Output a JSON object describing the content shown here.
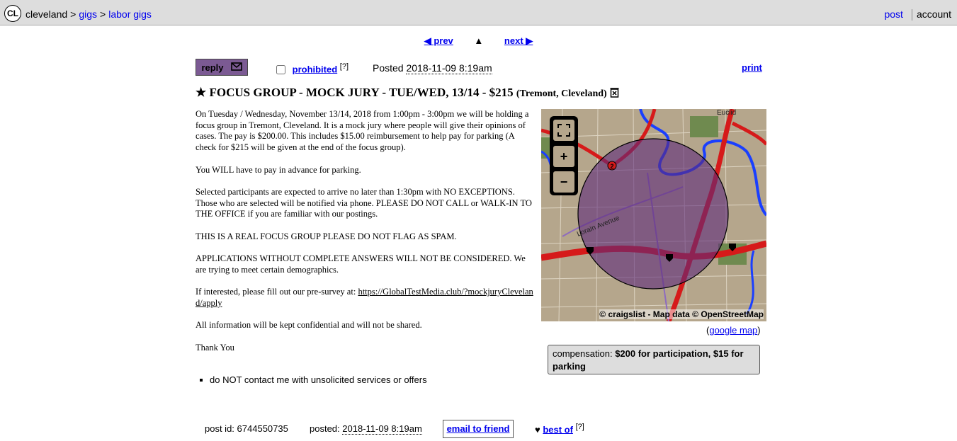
{
  "header": {
    "logo": "CL",
    "breadcrumb": [
      {
        "label": "cleveland",
        "link": false
      },
      {
        "label": "gigs",
        "link": true
      },
      {
        "label": "labor gigs",
        "link": true
      }
    ],
    "sep": ">",
    "post_label": "post",
    "account_label": "account"
  },
  "pager": {
    "prev_label": "◀ prev",
    "up_label": "▲",
    "next_label": "next ▶"
  },
  "actions": {
    "reply_label": "reply",
    "prohibited_label": "prohibited",
    "help_mark": "[?]",
    "posted_label": "Posted",
    "posted_date": "2018-11-09 8:19am",
    "print_label": "print"
  },
  "title": {
    "star": "★",
    "text": "FOCUS GROUP - MOCK JURY - TUE/WED, 13/14 - $215",
    "location": "(Tremont, Cleveland)"
  },
  "body": {
    "paragraphs": [
      "On Tuesday / Wednesday, November 13/14, 2018 from 1:00pm - 3:00pm we will be holding a focus group in Tremont, Cleveland. It is a mock jury where people will give their opinions of cases. The pay is $200.00. This includes $15.00 reimbursement to help pay for parking (A check for $215 will be given at the end of the focus group).",
      "You WILL have to pay in advance for parking.",
      "Selected participants are expected to arrive no later than 1:30pm with NO EXCEPTIONS. Those who are selected will be notified via phone. PLEASE DO NOT CALL or WALK-IN TO THE OFFICE if you are familiar with our postings.",
      "THIS IS A REAL FOCUS GROUP PLEASE DO NOT FLAG AS SPAM.",
      "APPLICATIONS WITHOUT COMPLETE ANSWERS WILL NOT BE CONSIDERED. We are trying to meet certain demographics."
    ],
    "survey_intro": "If interested, please fill out our pre-survey at:",
    "survey_link": "https://GlobalTestMedia.club/?mockjuryCleveland/apply",
    "confidential": "All information will be kept confidential and will not be shared.",
    "signoff": "Thank You",
    "notice": "do NOT contact me with unsolicited services or offers"
  },
  "map": {
    "attribution": "© craigslist - Map data © OpenStreetMap",
    "street_label": "Lorain Avenue",
    "corner_label": "Euclid",
    "route_marker": "2",
    "zoom_in": "+",
    "zoom_out": "−",
    "google_open": "(",
    "google_map_label": "google map",
    "google_close": ")"
  },
  "compensation": {
    "label": "compensation:",
    "value": "$200 for participation, $15 for parking"
  },
  "footer": {
    "post_id_label": "post id:",
    "post_id": "6744550735",
    "posted_label": "posted:",
    "posted_date": "2018-11-09 8:19am",
    "email_label": "email to friend",
    "heart": "♥",
    "best_of_label": "best of",
    "help_mark": "[?]"
  }
}
